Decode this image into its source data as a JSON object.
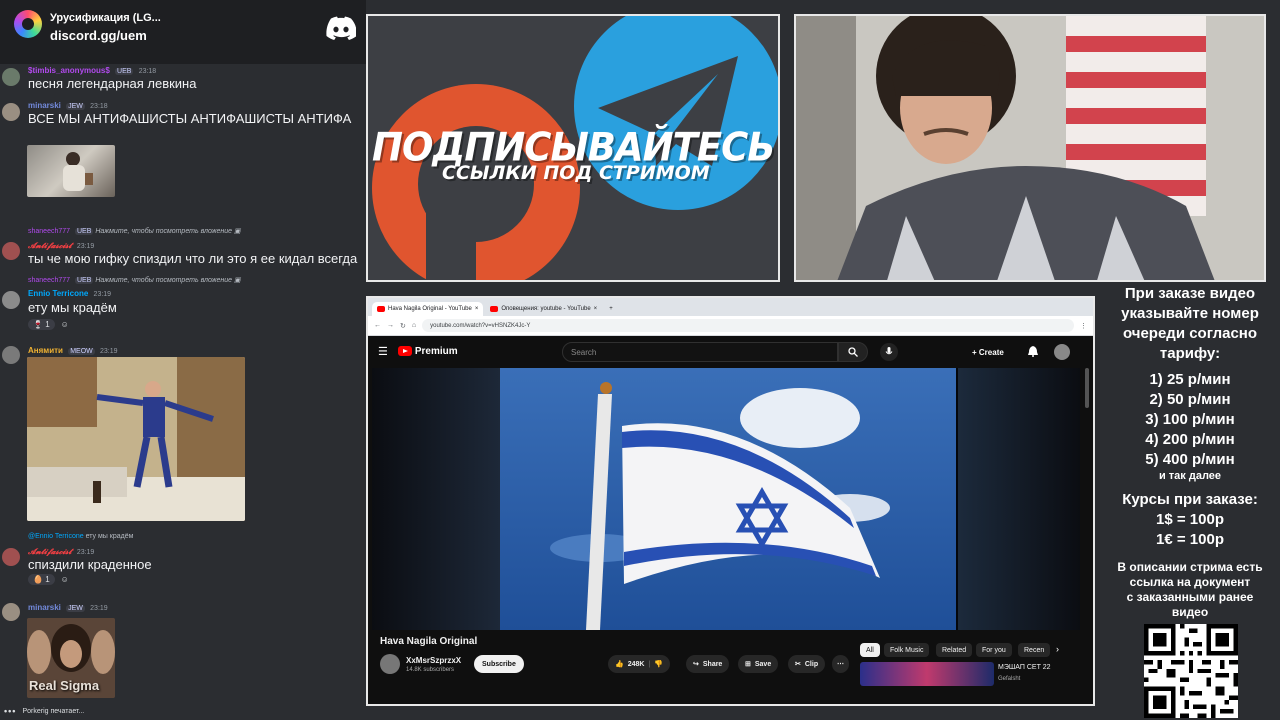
{
  "server": {
    "name": "Урусификация (LG...",
    "invite": "discord.gg/uem"
  },
  "messages": [
    {
      "user": "$timbis_anonymous$",
      "badge": "UEB",
      "time": "23:18",
      "text": "песня легендарная левкина",
      "color": "#b14aed"
    },
    {
      "user": "minarski",
      "badge": "JEW",
      "time": "23:18",
      "text": "ВСЕ МЫ АНТИФАШИСТЫ АНТИФАШИСТЫ АНТИФА",
      "color": "#5865f2"
    },
    {
      "reply_user": "shaneech777",
      "reply_text": "Нажмите, чтобы посмотреть вложение",
      "user": "𝓐𝓷𝓽𝓲𝓯𝓪𝓼𝓬𝓲𝓼𝓽",
      "time": "23:19",
      "text": "ты че мою гифку спиздил что ли это я ее кидал всегда",
      "color": "#f23f43"
    },
    {
      "reply_user": "shaneech777",
      "reply_text": "Нажмите, чтобы посмотреть вложение",
      "user": "Ennio Terricone",
      "time": "23:19",
      "text": "ету мы крадём",
      "reaction_count": "1",
      "color": "#00a8fc"
    },
    {
      "user": "Анямити",
      "badge": "MEOW",
      "time": "23:19",
      "color": "#f0b232"
    },
    {
      "reply_user": "@Ennio Terricone",
      "reply_text": "ету мы крадём",
      "user": "𝓐𝓷𝓽𝓲𝓯𝓪𝓼𝓬𝓲𝓼𝓽",
      "time": "23:19",
      "text": "спиздили краденное",
      "reaction_count": "1",
      "color": "#f23f43"
    },
    {
      "user": "minarski",
      "badge": "JEW",
      "time": "23:19",
      "image_caption": "Real Sigma",
      "color": "#5865f2"
    }
  ],
  "typing": "Porkerig печатает...",
  "promo": {
    "title": "ПОДПИСЫВАЙТЕСЬ",
    "subtitle": "ССЫЛКИ ПОД СТРИМОМ",
    "patreon_color": "#e0552f",
    "telegram_color": "#2aa0de"
  },
  "browser": {
    "tabs": [
      "Hava Nagila Original - YouTube",
      "Оповещения: youtube - YouTube"
    ],
    "url": "youtube.com/watch?v=vHSNZK4Jc-Y"
  },
  "youtube": {
    "logo_text": "Premium",
    "search_placeholder": "Search",
    "create_label": "Create",
    "video_title": "Hava Nagila Original",
    "channel_name": "XxMsrSzprzxX",
    "channel_subs": "14.8K subscribers",
    "subscribe_label": "Subscribe",
    "likes": "248K",
    "share_label": "Share",
    "save_label": "Save",
    "clip_label": "Clip",
    "chips": [
      "All",
      "Folk Music",
      "Related",
      "For you",
      "Recen"
    ],
    "rec_title": "МЭШАП СЕТ 22",
    "rec_channel": "Gefalsht"
  },
  "info": {
    "lines_top": [
      "При заказе видео",
      "указывайте номер",
      "очереди согласно",
      "тарифу:"
    ],
    "tariffs": [
      "1) 25 р/мин",
      "2) 50 р/мин",
      "3) 100 р/мин",
      "4) 200 р/мин",
      "5) 400 р/мин"
    ],
    "tariffs_more": "и так далее",
    "rates_title": "Курсы при заказе:",
    "rates": [
      "1$ = 100р",
      "1€ = 100р"
    ],
    "desc_lines": [
      "В описании стрима есть",
      "ссылка на документ",
      "с заказанными ранее",
      "видео"
    ]
  }
}
